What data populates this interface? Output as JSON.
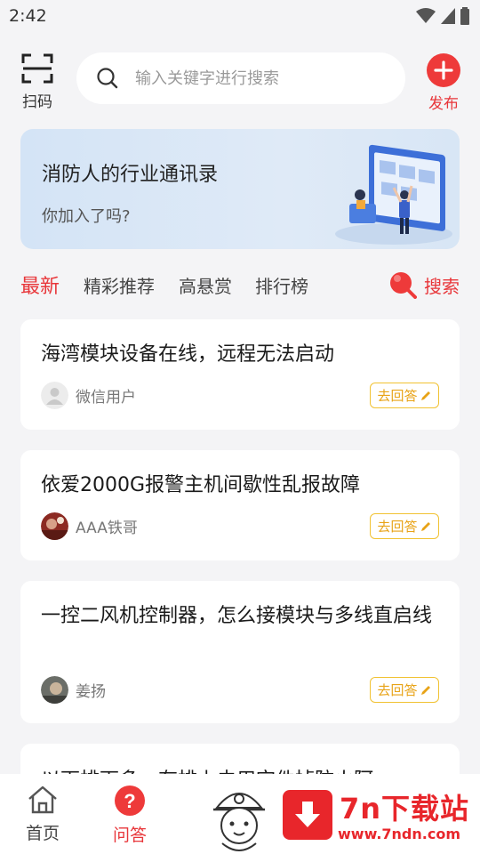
{
  "status_bar": {
    "time": "2:42"
  },
  "header": {
    "scan_label": "扫码",
    "search_placeholder": "输入关键字进行搜索",
    "publish_label": "发布"
  },
  "banner": {
    "title": "消防人的行业通讯录",
    "subtitle": "你加入了吗?"
  },
  "tabs": {
    "items": [
      "最新",
      "精彩推荐",
      "高悬赏",
      "排行榜"
    ],
    "active_index": 0,
    "search_label": "搜索"
  },
  "questions": [
    {
      "title": "海湾模块设备在线，远程无法启动",
      "user": "微信用户",
      "action": "去回答"
    },
    {
      "title": "依爱2000G报警主机间歇性乱报故障",
      "user": "AAA铁哥",
      "action": "去回答"
    },
    {
      "title": "一控二风机控制器，怎么接模块与多线直启线",
      "user": "姜扬",
      "action": "去回答"
    },
    {
      "title": "以下排下多一有排上去用空件掉防火阿"
    }
  ],
  "bottom_nav": {
    "items": [
      {
        "label": "首页",
        "icon": "home-icon"
      },
      {
        "label": "问答",
        "icon": "question-icon"
      }
    ],
    "active_index": 1
  },
  "watermark": {
    "title": "7n下载站",
    "url": "www.7ndn.com"
  },
  "colors": {
    "accent": "#e8363a",
    "answer": "#e8a317",
    "background": "#f4f4f6"
  }
}
